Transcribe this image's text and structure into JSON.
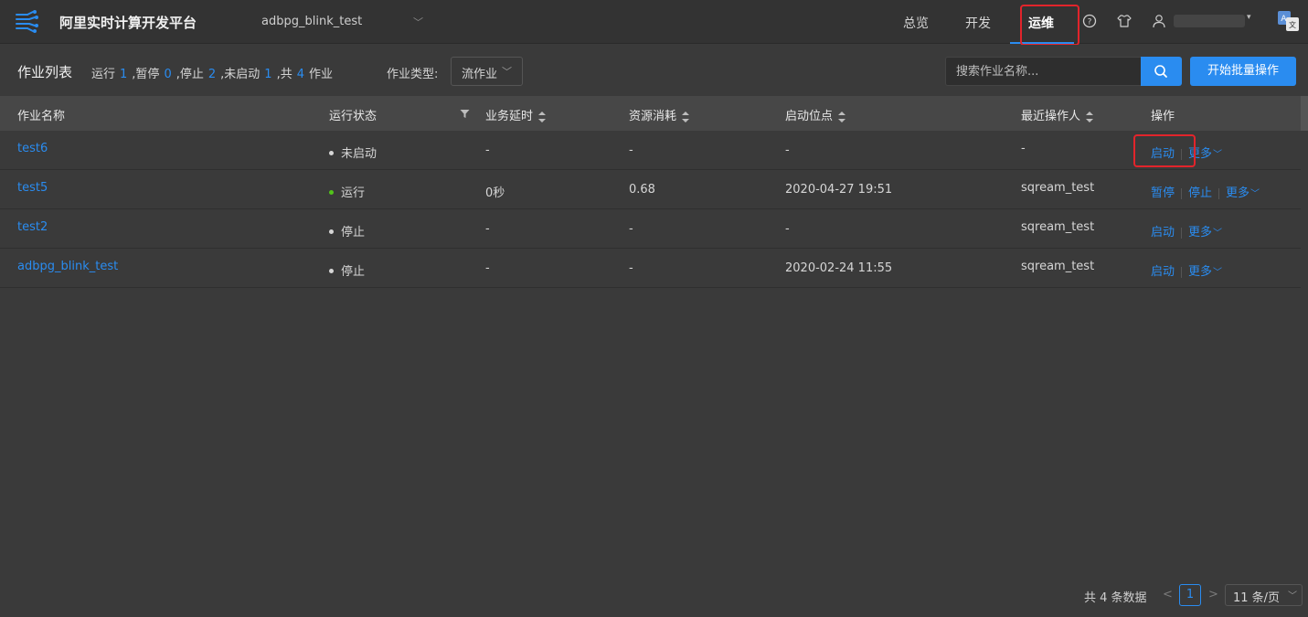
{
  "header": {
    "app_title": "阿里实时计算开发平台",
    "project": "adbpg_blink_test",
    "nav": [
      {
        "label": "总览",
        "active": false
      },
      {
        "label": "开发",
        "active": false
      },
      {
        "label": "运维",
        "active": true
      }
    ],
    "icons": [
      "help-icon",
      "theme-icon",
      "user-icon",
      "translate-icon"
    ],
    "accent_color": "#2a8cf0",
    "highlight_color": "#e2242b"
  },
  "toolbar": {
    "title": "作业列表",
    "stats": {
      "running_label": "运行",
      "running": "1",
      "paused_label": ",暂停",
      "paused": "0",
      "stopped_label": ",停止",
      "stopped": "2",
      "not_started_label": ",未启动",
      "not_started": "1",
      "total_label": ",共",
      "total": "4",
      "unit": "作业"
    },
    "type_label": "作业类型:",
    "type_value": "流作业",
    "search_placeholder": "搜索作业名称...",
    "batch_button": "开始批量操作"
  },
  "table": {
    "columns": [
      "作业名称",
      "运行状态",
      "业务延时",
      "资源消耗",
      "启动位点",
      "最近操作人",
      "操作"
    ],
    "rows": [
      {
        "name": "test6",
        "status": "未启动",
        "status_kind": "idle",
        "delay": "-",
        "resource": "-",
        "start_point": "-",
        "operator": "-",
        "actions": [
          "启动",
          "更多"
        ]
      },
      {
        "name": "test5",
        "status": "运行",
        "status_kind": "running",
        "delay": "0秒",
        "resource": "0.68",
        "start_point": "2020-04-27 19:51",
        "operator": "sqream_test",
        "actions": [
          "暂停",
          "停止",
          "更多"
        ]
      },
      {
        "name": "test2",
        "status": "停止",
        "status_kind": "idle",
        "delay": "-",
        "resource": "-",
        "start_point": "-",
        "operator": "sqream_test",
        "actions": [
          "启动",
          "更多"
        ]
      },
      {
        "name": "adbpg_blink_test",
        "status": "停止",
        "status_kind": "idle",
        "delay": "-",
        "resource": "-",
        "start_point": "2020-02-24 11:55",
        "operator": "sqream_test",
        "actions": [
          "启动",
          "更多"
        ]
      }
    ]
  },
  "pagination": {
    "total_text": "共 4 条数据",
    "current_page": "1",
    "page_size": "11 条/页"
  }
}
